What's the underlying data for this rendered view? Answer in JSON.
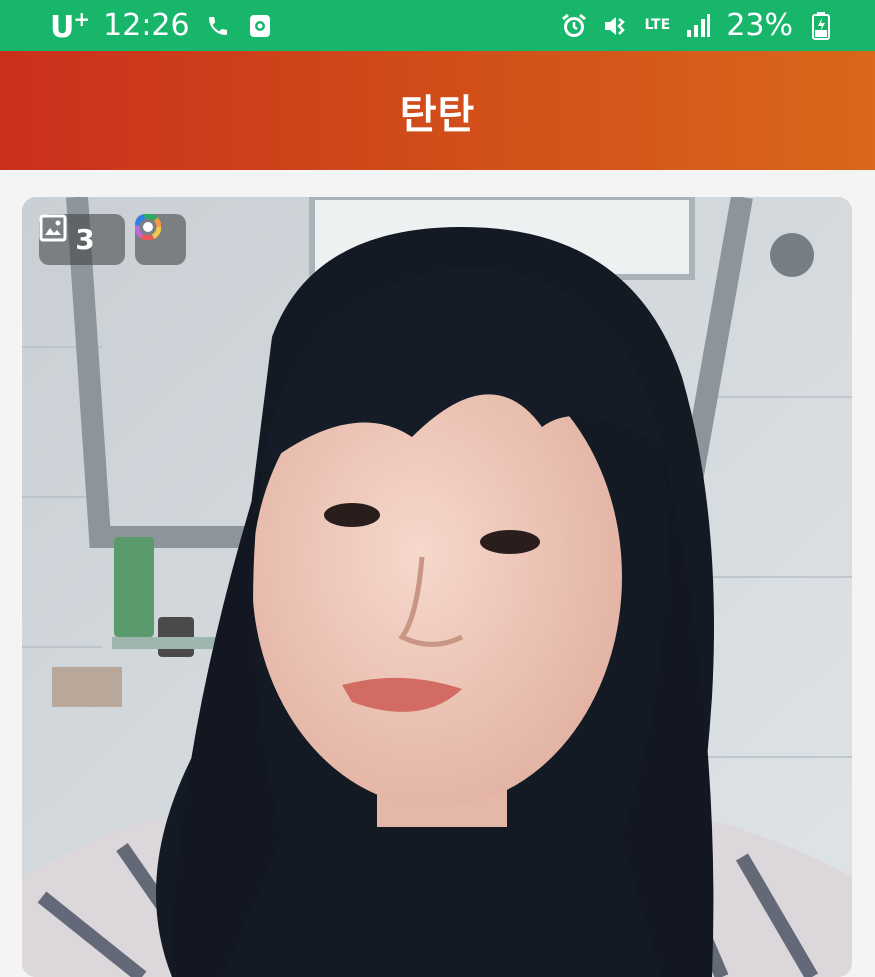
{
  "status_bar": {
    "carrier": "U",
    "carrier_sup": "+",
    "time": "12:26",
    "lte": "LTE",
    "battery": "23%"
  },
  "app_bar": {
    "title": "탄탄"
  },
  "photo_card": {
    "image_count": "3"
  },
  "colors": {
    "status_bar": "#17b66b",
    "app_bar_start": "#c9301c",
    "app_bar_end": "#d9681a"
  },
  "icons": [
    "phone-icon",
    "screen-record-icon",
    "alarm-icon",
    "mute-icon",
    "signal-icon",
    "battery-icon",
    "image-icon",
    "color-filter-icon"
  ]
}
